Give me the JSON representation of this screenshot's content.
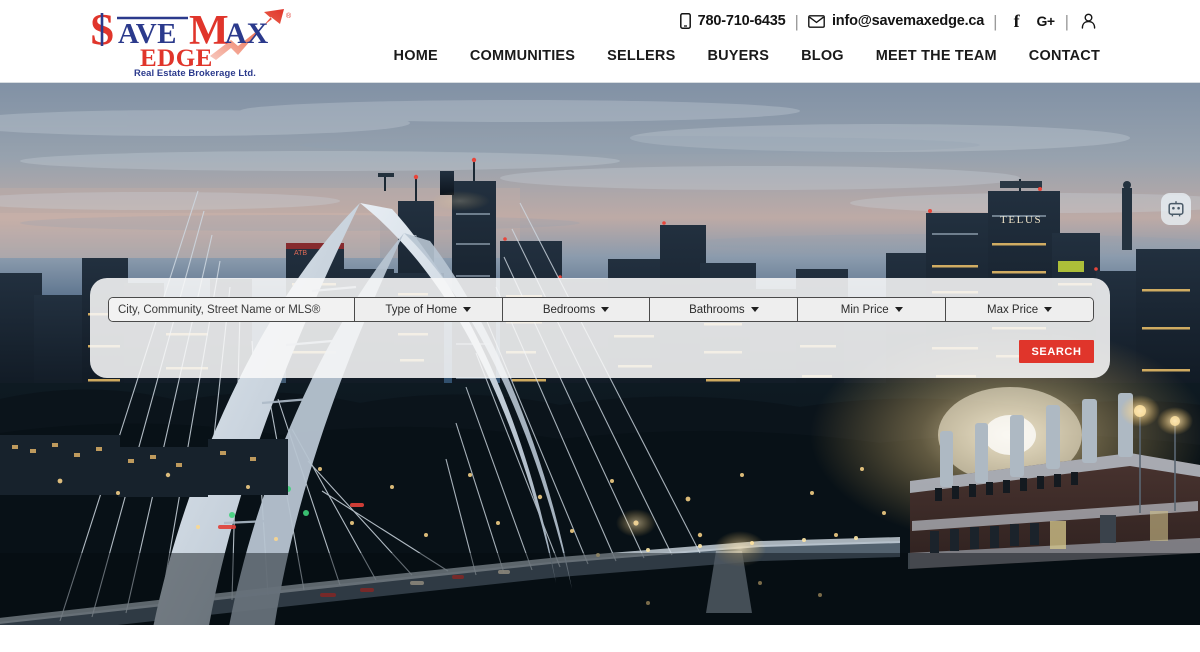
{
  "header": {
    "logo": {
      "name": "Save Max Edge",
      "word_top_1": "AVE",
      "word_top_2": "M",
      "word_top_3": "AX",
      "word_bottom": "EDGE",
      "tagline": "Real Estate Brokerage Ltd.",
      "registered_mark": "®",
      "dollar": "$",
      "color_red": "#E03127",
      "color_blue": "#2B3A8C"
    },
    "contact": {
      "phone": "780-710-6435",
      "phone_icon": "mobile-phone-icon",
      "email": "info@savemaxedge.ca",
      "email_icon": "envelope-icon",
      "separator": "|"
    },
    "social": [
      {
        "name": "facebook",
        "glyph": "f",
        "icon": "facebook-icon"
      },
      {
        "name": "googleplus",
        "glyph": "G+",
        "icon": "google-plus-icon"
      },
      {
        "name": "account",
        "glyph": "",
        "icon": "user-account-icon"
      }
    ],
    "nav": [
      {
        "label": "HOME",
        "key": "home"
      },
      {
        "label": "COMMUNITIES",
        "key": "communities"
      },
      {
        "label": "SELLERS",
        "key": "sellers"
      },
      {
        "label": "BUYERS",
        "key": "buyers"
      },
      {
        "label": "BLOG",
        "key": "blog"
      },
      {
        "label": "MEET THE TEAM",
        "key": "meet-the-team"
      },
      {
        "label": "CONTACT",
        "key": "contact"
      }
    ]
  },
  "hero": {
    "description": "Edmonton skyline at dusk with Walterdale Bridge and Rossdale power plant",
    "widget": {
      "name": "chat-bot-widget",
      "icon": "robot-chat-icon"
    }
  },
  "search": {
    "location_placeholder": "City, Community, Street Name or MLS®",
    "location_value": "",
    "fields": [
      {
        "key": "type_of_home",
        "label": "Type of Home",
        "icon": "chevron-down-icon"
      },
      {
        "key": "bedrooms",
        "label": "Bedrooms",
        "icon": "chevron-down-icon"
      },
      {
        "key": "bathrooms",
        "label": "Bathrooms",
        "icon": "chevron-down-icon"
      },
      {
        "key": "min_price",
        "label": "Min Price",
        "icon": "chevron-down-icon"
      },
      {
        "key": "max_price",
        "label": "Max Price",
        "icon": "chevron-down-icon"
      }
    ],
    "submit_label": "SEARCH",
    "submit_color": "#E0352B"
  }
}
